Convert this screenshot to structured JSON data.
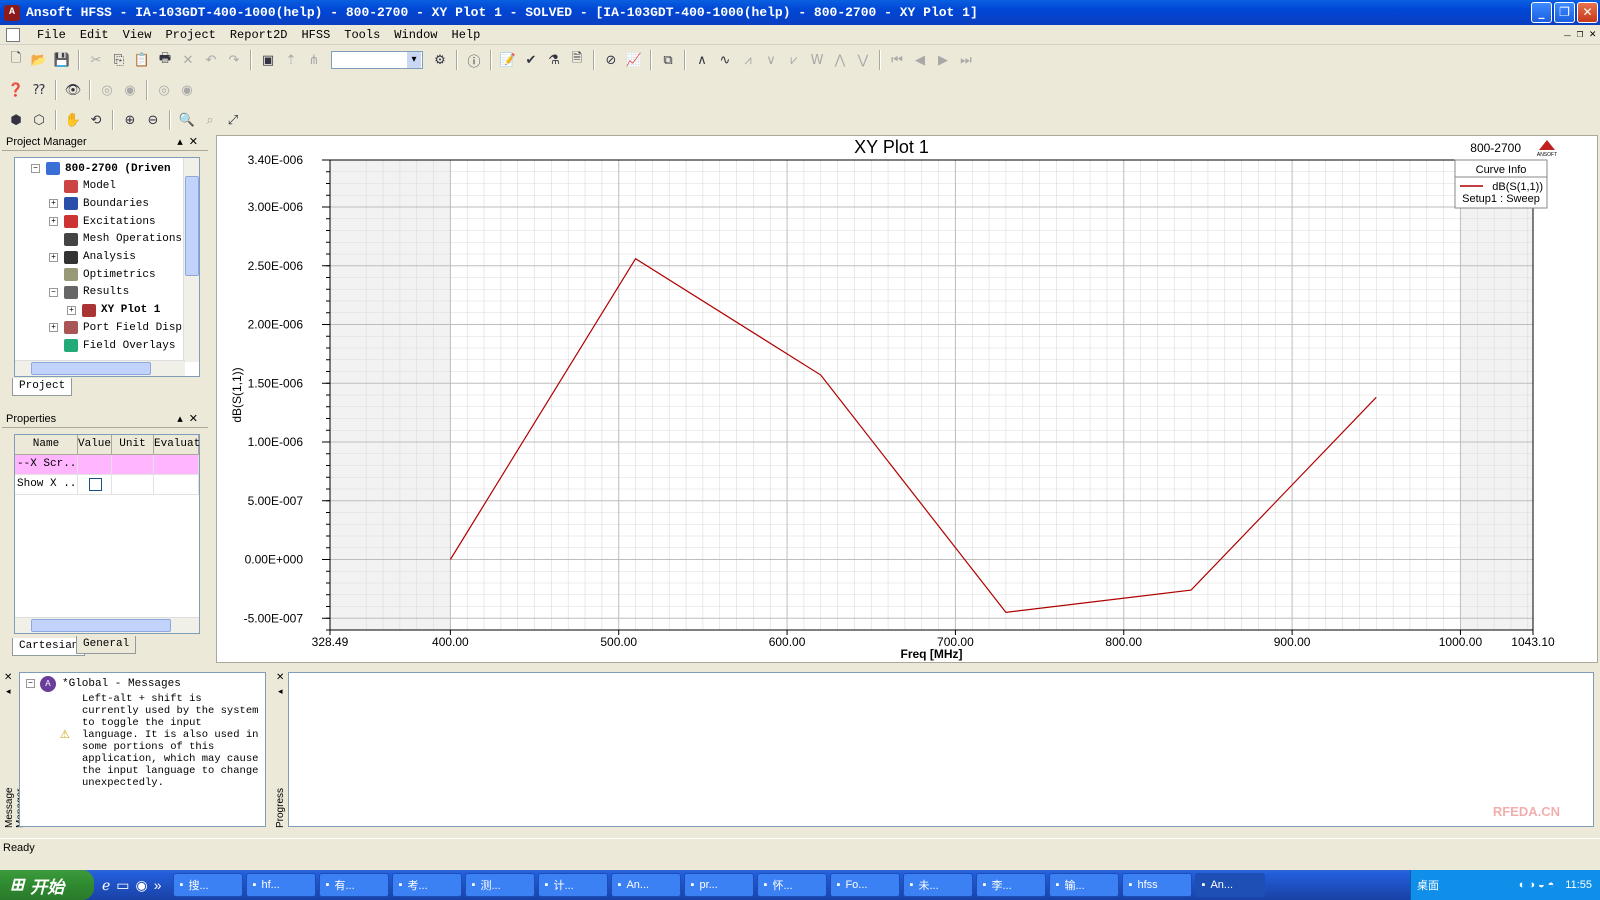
{
  "window": {
    "title": "Ansoft HFSS  - IA-103GDT-400-1000(help) - 800-2700 - XY Plot 1 - SOLVED - [IA-103GDT-400-1000(help) - 800-2700 - XY Plot 1]"
  },
  "menu": [
    "File",
    "Edit",
    "View",
    "Project",
    "Report2D",
    "HFSS",
    "Tools",
    "Window",
    "Help"
  ],
  "project_manager": {
    "title": "Project Manager",
    "tree": [
      {
        "label": "800-2700 (Driven",
        "bold": true,
        "expander": "−",
        "indent": 0,
        "color": "#3a6fd8"
      },
      {
        "label": "Model",
        "bold": false,
        "expander": "",
        "indent": 1,
        "color": "#c44"
      },
      {
        "label": "Boundaries",
        "bold": false,
        "expander": "+",
        "indent": 1,
        "color": "#2a4fa8"
      },
      {
        "label": "Excitations",
        "bold": false,
        "expander": "+",
        "indent": 1,
        "color": "#c33"
      },
      {
        "label": "Mesh Operations",
        "bold": false,
        "expander": "",
        "indent": 1,
        "color": "#444"
      },
      {
        "label": "Analysis",
        "bold": false,
        "expander": "+",
        "indent": 1,
        "color": "#333"
      },
      {
        "label": "Optimetrics",
        "bold": false,
        "expander": "",
        "indent": 1,
        "color": "#997"
      },
      {
        "label": "Results",
        "bold": false,
        "expander": "−",
        "indent": 1,
        "color": "#666"
      },
      {
        "label": "XY Plot 1",
        "bold": true,
        "expander": "+",
        "indent": 2,
        "color": "#a33"
      },
      {
        "label": "Port Field Disp",
        "bold": false,
        "expander": "+",
        "indent": 1,
        "color": "#a55"
      },
      {
        "label": "Field Overlays",
        "bold": false,
        "expander": "",
        "indent": 1,
        "color": "#2a7"
      }
    ],
    "tab": "Project"
  },
  "properties": {
    "title": "Properties",
    "columns": [
      "Name",
      "Value",
      "Unit",
      "Evaluat"
    ],
    "rows": [
      {
        "name": "--X Scr...",
        "value": "",
        "unit": "",
        "eval": ""
      },
      {
        "name": "Show X ...",
        "value": "",
        "unit": "",
        "eval": ""
      }
    ],
    "tabs": [
      "Cartesian",
      "General"
    ]
  },
  "plot": {
    "title": "XY Plot 1",
    "setup_label": "800-2700",
    "logo": "ANSOFT",
    "curve_info_title": "Curve Info",
    "curve_name": "dB(S(1,1))",
    "curve_setup": "Setup1 : Sweep",
    "curve_color": "#b00000"
  },
  "chart_data": {
    "type": "line",
    "title": "XY Plot 1",
    "xlabel": "Freq [MHz]",
    "ylabel": "dB(S(1,1))",
    "xlim": [
      328.49,
      1043.1
    ],
    "ylim": [
      -6e-07,
      3.4e-06
    ],
    "x_ticks": [
      "328.49",
      "400.00",
      "500.00",
      "600.00",
      "700.00",
      "800.00",
      "900.00",
      "1000.00",
      "1043.10"
    ],
    "x_tick_values": [
      328.49,
      400,
      500,
      600,
      700,
      800,
      900,
      1000,
      1043.1
    ],
    "y_ticks": [
      "3.40E-006",
      "3.00E-006",
      "2.50E-006",
      "2.00E-006",
      "1.50E-006",
      "1.00E-006",
      "5.00E-007",
      "0.00E+000",
      "-5.00E-007"
    ],
    "y_tick_values": [
      3.4e-06,
      3e-06,
      2.5e-06,
      2e-06,
      1.5e-06,
      1e-06,
      5e-07,
      0,
      -5e-07
    ],
    "grid": true,
    "legend": "top-right",
    "series": [
      {
        "name": "dB(S(1,1))",
        "color": "#b00000",
        "x": [
          400,
          510,
          620,
          730,
          840,
          950
        ],
        "y": [
          0.0,
          2.56e-06,
          1.57e-06,
          -4.5e-07,
          -2.6e-07,
          1.38e-06
        ]
      }
    ]
  },
  "messages": {
    "panel_label": "Message Manager",
    "header": "*Global - Messages",
    "text": "Left-alt + shift is currently used by the system to toggle the input language. It is also used in some portions of this application, which may cause the input language to change unexpectedly."
  },
  "progress": {
    "panel_label": "Progress"
  },
  "status": {
    "text": "Ready"
  },
  "taskbar": {
    "start": "开始",
    "tasks": [
      "搜...",
      "hf...",
      "有...",
      "考...",
      "测...",
      "计...",
      "An...",
      "pr...",
      "怀...",
      "Fo...",
      "未...",
      "李...",
      "输...",
      "hfss",
      "An..."
    ],
    "tray_desktop": "桌面",
    "clock": "11:55"
  },
  "watermark": {
    "text": "RFEDA.CN"
  }
}
